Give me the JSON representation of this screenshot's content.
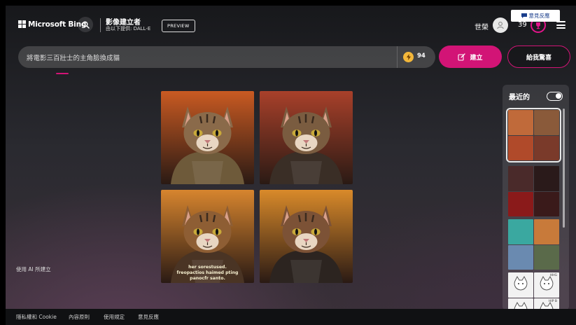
{
  "header": {
    "brand": "Microsoft Bing",
    "creator_title": "影像建立者",
    "creator_subtitle": "由以下提供: DALL-E",
    "preview_badge": "PREVIEW",
    "user_name": "世榮",
    "reward_count": "39"
  },
  "prompt": {
    "value": "將電影三百壯士的主角臉換成貓",
    "boost_count": "94"
  },
  "buttons": {
    "create": "建立",
    "surprise": "給我驚喜"
  },
  "notes": {
    "ai_created": "使用 AI 所建立"
  },
  "images": [
    {
      "name": "cat-warrior-1",
      "bg": "#c95a22",
      "fur": "#8a6a4a",
      "armor": "#6e5a3a"
    },
    {
      "name": "cat-warrior-2",
      "bg": "#a8402a",
      "fur": "#7a5c40",
      "armor": "#3a2e26"
    },
    {
      "name": "cat-warrior-3",
      "bg": "#d7852e",
      "fur": "#8e5e34",
      "armor": "#4a3424"
    },
    {
      "name": "cat-warrior-4",
      "bg": "#d98a2a",
      "fur": "#7c5236",
      "armor": "#2c2420"
    }
  ],
  "image_caption": [
    "her sorestused.",
    "freopactios haimed pting",
    "panocfr santo."
  ],
  "sidebar": {
    "recent_label": "最近的",
    "sets": [
      {
        "colors": [
          "#c06a3a",
          "#8a5a3a",
          "#b04a2a",
          "#7a3a2a"
        ],
        "selected": true
      },
      {
        "colors": [
          "#4a2a2a",
          "#2a1a1a",
          "#8a1a1a",
          "#3a1a1a"
        ],
        "selected": false
      },
      {
        "colors": [
          "#3aa8a0",
          "#c87a3a",
          "#6a8ab0",
          "#5a6a4a"
        ],
        "selected": false
      },
      {
        "colors": [
          "#f2f2f2",
          "#f2f2f2",
          "#f2f2f2",
          "#f2f2f2"
        ],
        "selected": false
      }
    ],
    "sticker_labels": [
      "HHG",
      "HIP B"
    ]
  },
  "footer": {
    "links": [
      "隱私權和 Cookie",
      "內容原則",
      "使用規定",
      "意見反應"
    ],
    "feedback_button": "意見反應"
  }
}
